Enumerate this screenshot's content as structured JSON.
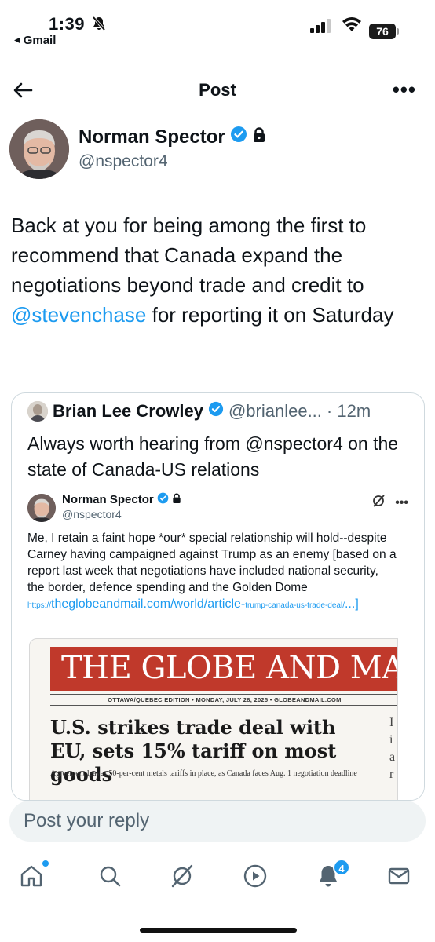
{
  "status": {
    "time": "1:39",
    "back_app": "Gmail",
    "battery": "76"
  },
  "header": {
    "title": "Post"
  },
  "author": {
    "name": "Norman Spector",
    "handle": "@nspector4"
  },
  "post": {
    "text_before": "Back at you for being among the first to recommend that Canada expand the negotiations beyond trade and credit to ",
    "mention": "@stevenchase",
    "text_after": " for reporting it on Saturday"
  },
  "quote": {
    "name": "Brian Lee Crowley",
    "handle": "@brianlee...",
    "time": "· 12m",
    "text": "Always worth hearing from @nspector4 on the state of Canada-US relations"
  },
  "screenshot": {
    "name": "Norman Spector",
    "handle": "@nspector4",
    "text": "Me, I retain a faint hope *our* special relationship will hold--despite Carney having campaigned against Trump as an enemy [based on a report last week that negotiations have included national security, the border, defence spending and the Golden Dome ",
    "link_prefix": "https://",
    "link_main": "theglobeandmail.com/world/article-",
    "link_suffix": "trump-canada-us-trade-deal/",
    "link_end": "...]",
    "masthead": "THE GLOBE AND MA",
    "edition": "OTTAWA/QUEBEC EDITION  •  MONDAY, JULY 28, 2025  •  GLOBEANDMAIL.COM",
    "headline": "U.S. strikes trade deal with EU, sets 15% tariff on most goods",
    "subhead": "Agreement leaves 50-per-cent metals tariffs in place, as Canada faces Aug. 1 negotiation deadline",
    "side_col": "I\ni\na\nr"
  },
  "reply": {
    "placeholder": "Post your reply"
  },
  "tabbar": {
    "notifications_count": "4"
  },
  "colors": {
    "accent": "#1d9bf0",
    "masthead": "#c0392b",
    "secondary_text": "#536471"
  }
}
